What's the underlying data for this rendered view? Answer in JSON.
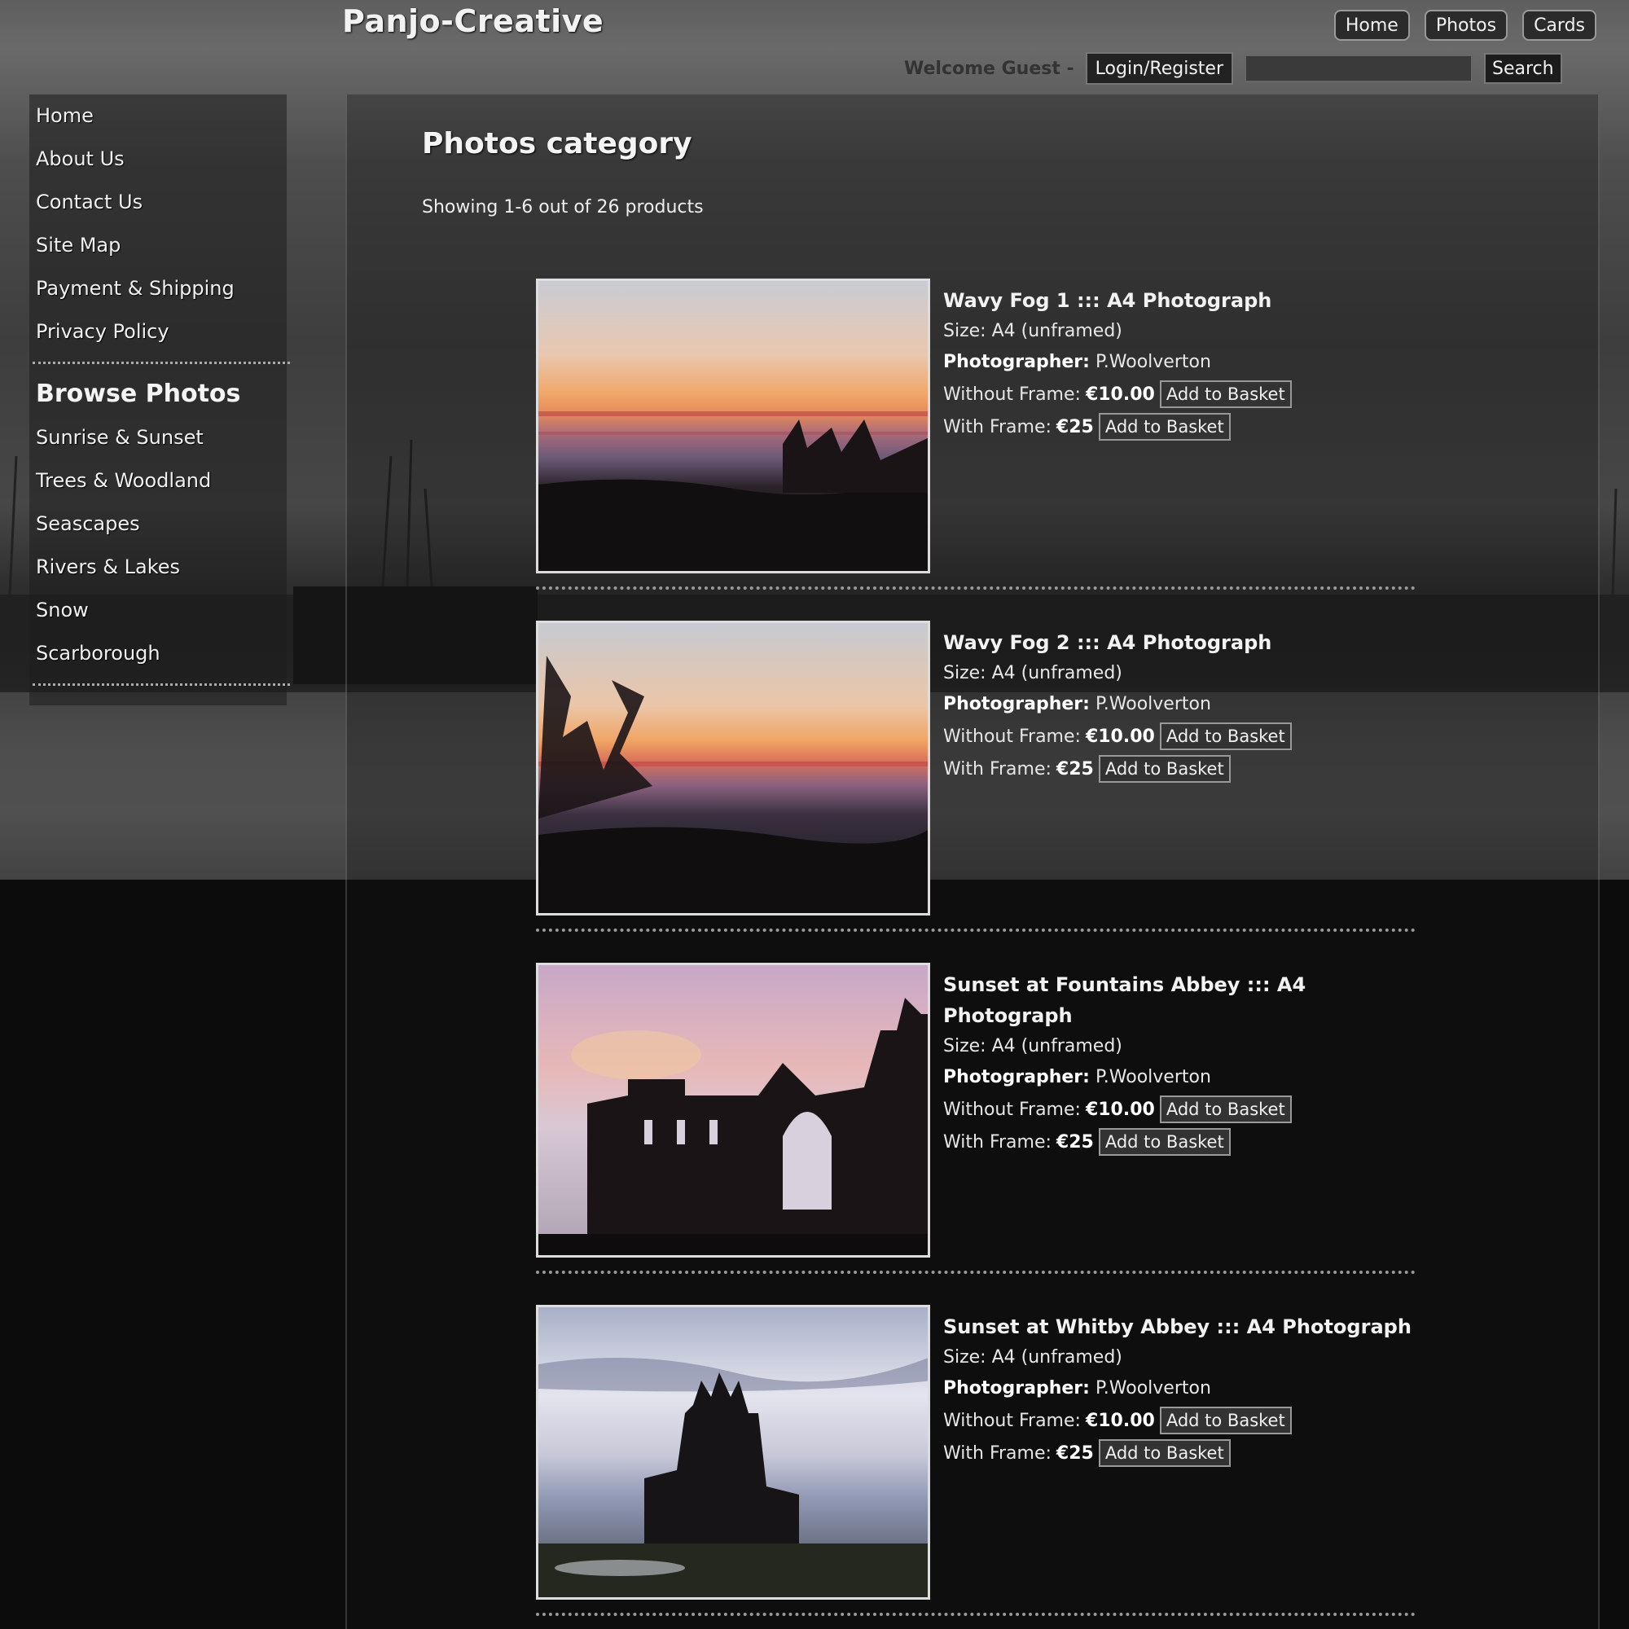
{
  "header": {
    "logo": "Panjo-Creative",
    "nav": [
      "Home",
      "Photos",
      "Cards"
    ],
    "welcome": "Welcome Guest -",
    "login_label": "Login/Register",
    "search_value": "",
    "search_label": "Search"
  },
  "sidebar": {
    "links": [
      "Home",
      "About Us",
      "Contact Us",
      "Site Map",
      "Payment & Shipping",
      "Privacy Policy"
    ],
    "browse_title": "Browse Photos",
    "categories": [
      "Sunrise & Sunset",
      "Trees & Woodland",
      "Seascapes",
      "Rivers & Lakes",
      "Snow",
      "Scarborough"
    ]
  },
  "main": {
    "title": "Photos category",
    "showing": "Showing 1-6 out of 26 products"
  },
  "products": [
    {
      "title": "Wavy Fog 1 ::: A4 Photograph",
      "size": "Size: A4 (unframed)",
      "photographer_label": "Photographer:",
      "photographer": "P.Woolverton",
      "without_label": "Without Frame:",
      "without_price": "€10.00",
      "with_label": "With Frame:",
      "with_price": "€25",
      "add_label": "Add to Basket"
    },
    {
      "title": "Wavy Fog 2 ::: A4 Photograph",
      "size": "Size: A4 (unframed)",
      "photographer_label": "Photographer:",
      "photographer": "P.Woolverton",
      "without_label": "Without Frame:",
      "without_price": "€10.00",
      "with_label": "With Frame:",
      "with_price": "€25",
      "add_label": "Add to Basket"
    },
    {
      "title": "Sunset at Fountains Abbey ::: A4 Photograph",
      "size": "Size: A4 (unframed)",
      "photographer_label": "Photographer:",
      "photographer": "P.Woolverton",
      "without_label": "Without Frame:",
      "without_price": "€10.00",
      "with_label": "With Frame:",
      "with_price": "€25",
      "add_label": "Add to Basket"
    },
    {
      "title": "Sunset at Whitby Abbey ::: A4 Photograph",
      "size": "Size: A4 (unframed)",
      "photographer_label": "Photographer:",
      "photographer": "P.Woolverton",
      "without_label": "Without Frame:",
      "without_price": "€10.00",
      "with_label": "With Frame:",
      "with_price": "€25",
      "add_label": "Add to Basket"
    }
  ]
}
